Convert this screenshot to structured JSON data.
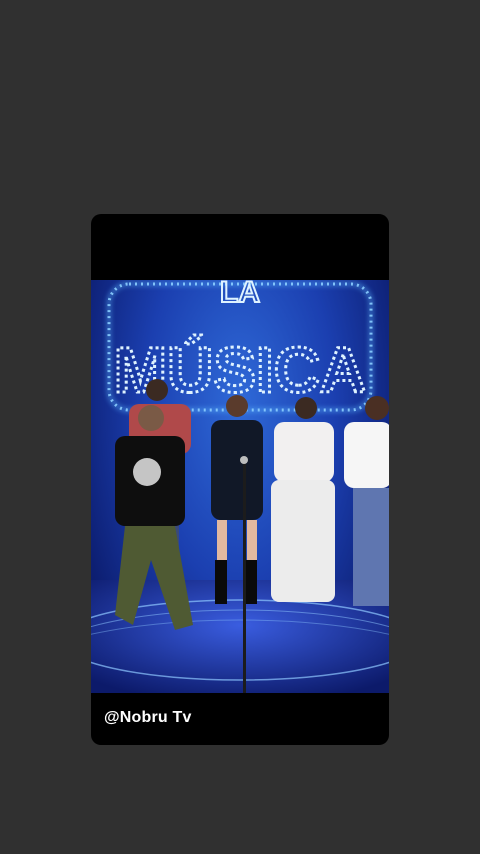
{
  "story": {
    "caption": "@Nobru Tv"
  },
  "video": {
    "sign_top": "LA",
    "sign_main": "MÚSICA",
    "colors": {
      "stage_blue": "#1b3fb0",
      "neon": "#bfe6ff",
      "floor": "#1a2fa8"
    }
  }
}
